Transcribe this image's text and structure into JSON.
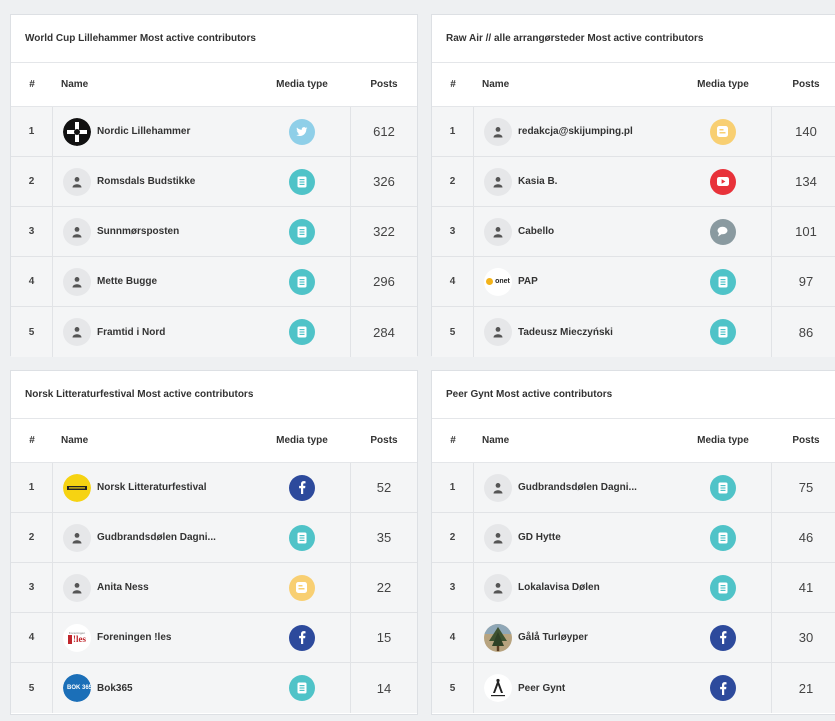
{
  "colors": {
    "twitter": "#8fcfe8",
    "news": "#4fc3c8",
    "blog": "#f8cf72",
    "youtube": "#e8323a",
    "forum": "#8a9aa0",
    "facebook": "#2d4a9c"
  },
  "panels": [
    {
      "title": "World Cup Lillehammer Most active contributors",
      "headers": {
        "rank": "#",
        "name": "Name",
        "media": "Media type",
        "posts": "Posts"
      },
      "rows": [
        {
          "rank": "1",
          "name": "Nordic Lillehammer",
          "avatar": "nordic-lillehammer-logo",
          "media": "twitter",
          "posts": "612"
        },
        {
          "rank": "2",
          "name": "Romsdals Budstikke",
          "avatar": "user-icon",
          "media": "news",
          "posts": "326"
        },
        {
          "rank": "3",
          "name": "Sunnmørsposten",
          "avatar": "user-icon",
          "media": "news",
          "posts": "322"
        },
        {
          "rank": "4",
          "name": "Mette Bugge",
          "avatar": "user-icon",
          "media": "news",
          "posts": "296"
        },
        {
          "rank": "5",
          "name": "Framtid i Nord",
          "avatar": "user-icon",
          "media": "news",
          "posts": "284"
        }
      ]
    },
    {
      "title": "Raw Air // alle arrangørsteder Most active contributors",
      "headers": {
        "rank": "#",
        "name": "Name",
        "media": "Media type",
        "posts": "Posts"
      },
      "rows": [
        {
          "rank": "1",
          "name": "redakcja@skijumping.pl",
          "avatar": "user-icon",
          "media": "blog",
          "posts": "140"
        },
        {
          "rank": "2",
          "name": "Kasia B.",
          "avatar": "user-icon",
          "media": "youtube",
          "posts": "134"
        },
        {
          "rank": "3",
          "name": "Cabello",
          "avatar": "user-icon",
          "media": "forum",
          "posts": "101"
        },
        {
          "rank": "4",
          "name": "PAP",
          "avatar": "onet-logo",
          "avatar_text": "onet",
          "media": "news",
          "posts": "97"
        },
        {
          "rank": "5",
          "name": "Tadeusz Mieczyński",
          "avatar": "user-icon",
          "media": "news",
          "posts": "86"
        }
      ]
    },
    {
      "title": "Norsk Litteraturfestival Most active contributors",
      "headers": {
        "rank": "#",
        "name": "Name",
        "media": "Media type",
        "posts": "Posts"
      },
      "rows": [
        {
          "rank": "1",
          "name": "Norsk Litteraturfestival",
          "avatar": "litteraturfestival-logo",
          "media": "facebook",
          "posts": "52"
        },
        {
          "rank": "2",
          "name": "Gudbrandsdølen Dagni...",
          "avatar": "user-icon",
          "media": "news",
          "posts": "35"
        },
        {
          "rank": "3",
          "name": "Anita Ness",
          "avatar": "user-icon",
          "media": "blog",
          "posts": "22"
        },
        {
          "rank": "4",
          "name": "Foreningen !les",
          "avatar": "les-logo",
          "avatar_text": "!les",
          "media": "facebook",
          "posts": "15"
        },
        {
          "rank": "5",
          "name": "Bok365",
          "avatar": "bok365-logo",
          "avatar_text": "BOK 365",
          "media": "news",
          "posts": "14"
        }
      ]
    },
    {
      "title": "Peer Gynt Most active contributors",
      "headers": {
        "rank": "#",
        "name": "Name",
        "media": "Media type",
        "posts": "Posts"
      },
      "rows": [
        {
          "rank": "1",
          "name": "Gudbrandsdølen Dagni...",
          "avatar": "user-icon",
          "media": "news",
          "posts": "75"
        },
        {
          "rank": "2",
          "name": "GD Hytte",
          "avatar": "user-icon",
          "media": "news",
          "posts": "46"
        },
        {
          "rank": "3",
          "name": "Lokalavisa Dølen",
          "avatar": "user-icon",
          "media": "news",
          "posts": "41"
        },
        {
          "rank": "4",
          "name": "Gålå Turløyper",
          "avatar": "galaturloyper-photo",
          "media": "facebook",
          "posts": "30"
        },
        {
          "rank": "5",
          "name": "Peer Gynt",
          "avatar": "peer-gynt-logo",
          "media": "facebook",
          "posts": "21"
        }
      ]
    }
  ]
}
